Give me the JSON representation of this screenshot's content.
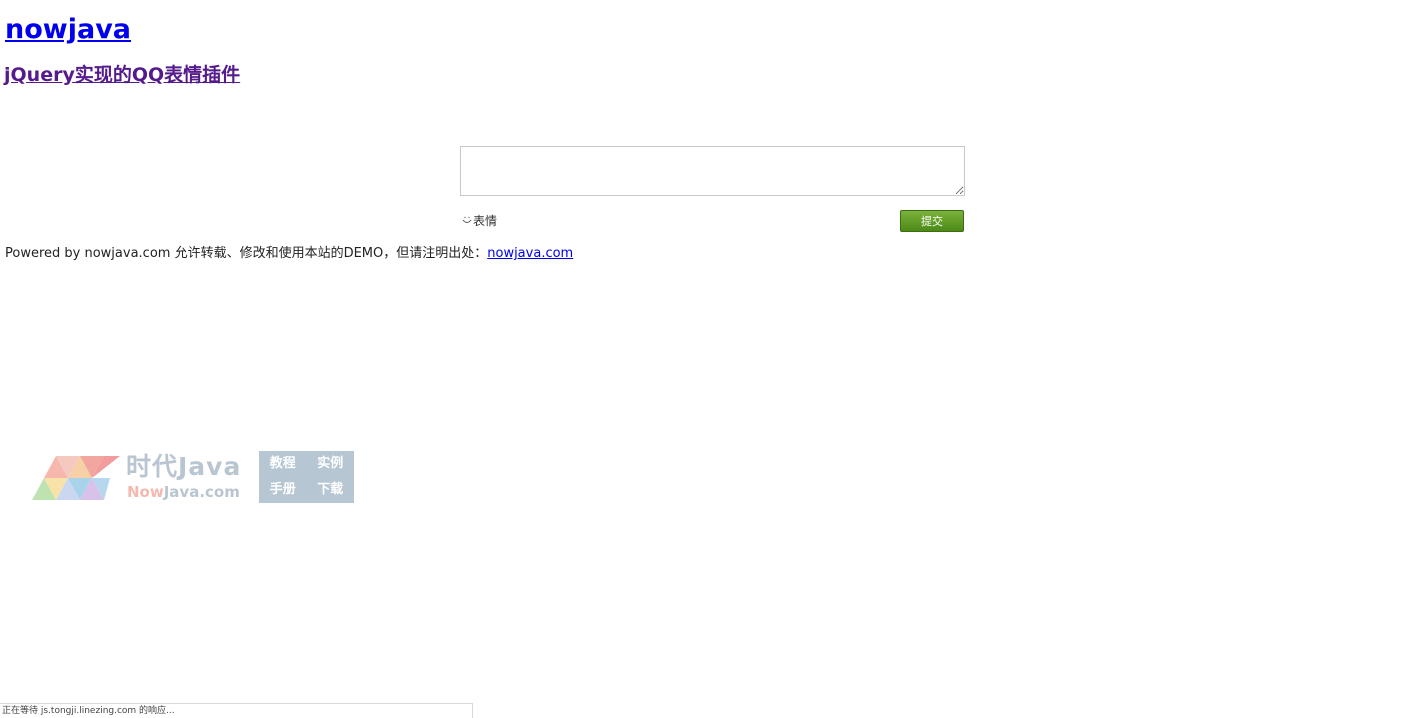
{
  "header": {
    "site_title": "nowjava",
    "page_heading": "jQuery实现的QQ表情插件"
  },
  "comment_form": {
    "textarea_value": "",
    "emotion_label": "表情",
    "emotion_icon": "smile-icon",
    "submit_label": "提交",
    "submit_color": "#5a9a22"
  },
  "footer": {
    "text": "Powered by nowjava.com 允许转载、修改和使用本站的DEMO，但请注明出处：",
    "link_text": "nowjava.com"
  },
  "watermark": {
    "brand_name": "时代Java",
    "brand_url_accent": "Now",
    "brand_url_rest": "Java.com",
    "nav": [
      "教程",
      "实例",
      "手册",
      "下载"
    ],
    "colors": {
      "text": "#b9c6d1",
      "accent": "#f3b9b0",
      "box": "#b6c6d3"
    }
  },
  "status_bar": {
    "text": "正在等待 js.tongji.linezing.com 的响应..."
  }
}
